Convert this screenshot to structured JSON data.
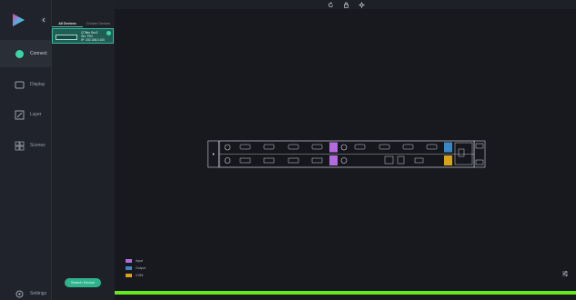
{
  "nav": {
    "items": [
      {
        "label": "Connect",
        "icon": "connect-icon"
      },
      {
        "label": "Display",
        "icon": "display-icon"
      },
      {
        "label": "Layer",
        "icon": "layer-icon"
      },
      {
        "label": "Scenes",
        "icon": "scenes-icon"
      }
    ],
    "settings_label": "Settings"
  },
  "panel": {
    "tabs": [
      "All Devices",
      "Chosen Devices"
    ],
    "device": {
      "name": "Q'Tiles Sec2",
      "version": "Ver: P0V",
      "ip": "IP: 192.168.0.100"
    },
    "search_button": "Search Device"
  },
  "legend": [
    {
      "label": "Input",
      "color": "#b46be0"
    },
    {
      "label": "Output",
      "color": "#3a87c8"
    },
    {
      "label": "COM",
      "color": "#d8a21c"
    }
  ],
  "colors": {
    "accent": "#2fb38c",
    "progress": "#66e81c"
  }
}
